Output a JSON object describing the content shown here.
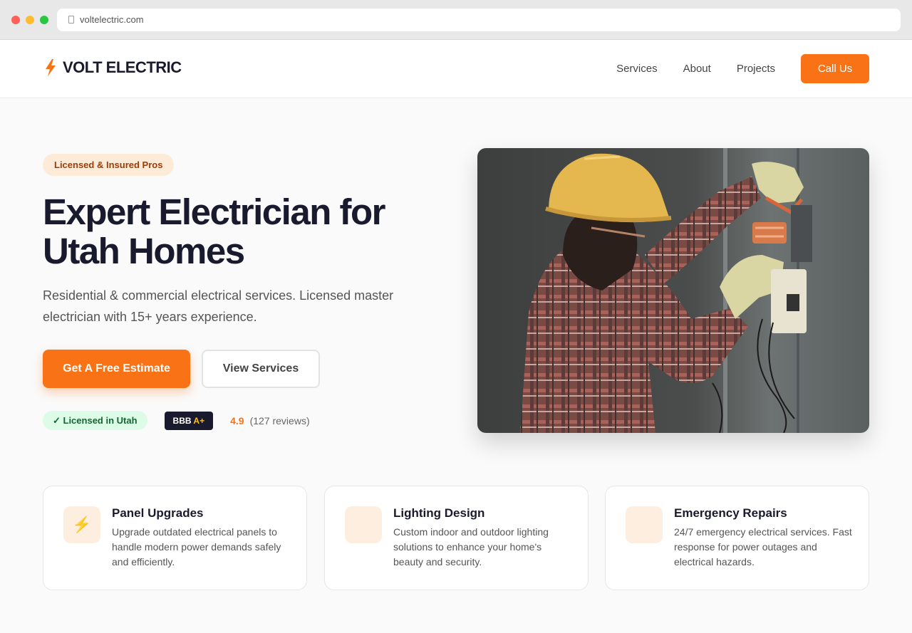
{
  "browser": {
    "url": "voltelectric.com"
  },
  "header": {
    "logo_text": "VOLT ELECTRIC",
    "logo_icon": "lightning-bolt-icon",
    "nav": [
      "Services",
      "About",
      "Projects"
    ],
    "cta_label": "Call Us"
  },
  "hero": {
    "badge": "Licensed & Insured Pros",
    "headline": "Expert Electrician for Utah Homes",
    "subtitle": "Residential & commercial electrical services. Licensed master electrician with 15+ years experience.",
    "primary_button": "Get A Free Estimate",
    "secondary_button": "View Services",
    "trust": {
      "licensed": "✓ Licensed in Utah",
      "bbb_label": "BBB",
      "bbb_grade": "A+",
      "rating": "4.9",
      "reviews": "(127 reviews)"
    },
    "photo_alt_icon": "electrician-photo"
  },
  "services": [
    {
      "icon": "lightning-icon",
      "glyph": "⚡",
      "title": "Panel Upgrades",
      "description": "Upgrade outdated electrical panels to handle modern power demands safely and efficiently."
    },
    {
      "icon": "lightbulb-icon",
      "glyph": "",
      "title": "Lighting Design",
      "description": "Custom indoor and outdoor lighting solutions to enhance your home's beauty and security."
    },
    {
      "icon": "wrench-icon",
      "glyph": "",
      "title": "Emergency Repairs",
      "description": "24/7 emergency electrical services. Fast response for power outages and electrical hazards."
    }
  ],
  "colors": {
    "accent": "#f97316",
    "dark": "#1a1a2e",
    "badge_bg": "#fdebd8",
    "licensed_bg": "#dcfce7"
  }
}
